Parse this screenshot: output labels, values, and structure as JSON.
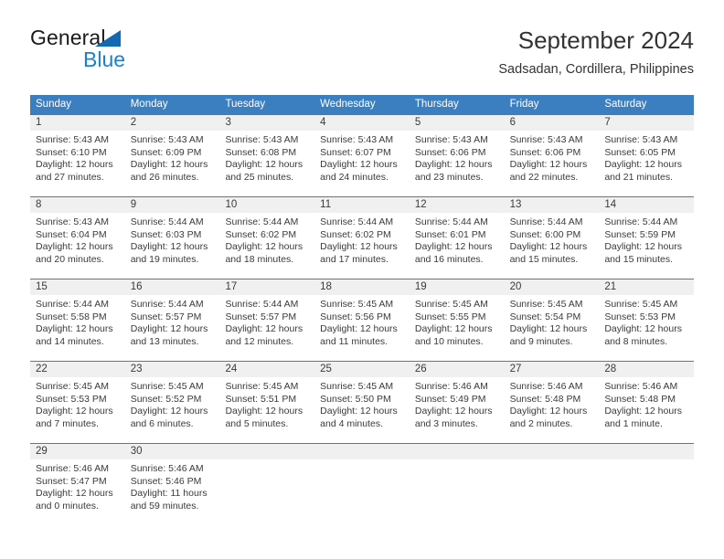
{
  "logo": {
    "word_top": "General",
    "word_bottom": "Blue",
    "triangle_icon": "triangle-icon",
    "color_dark": "#1a1a1a",
    "color_blue": "#1b7fd4"
  },
  "header": {
    "title": "September 2024",
    "subtitle": "Sadsadan, Cordillera, Philippines"
  },
  "theme": {
    "header_bg": "#3c7fc1",
    "header_text": "#ffffff",
    "daynum_bg": "#f0f0f0",
    "cell_bg": "#ffffff",
    "text": "#3a3a3a",
    "week_divider": "#3c7fc1"
  },
  "weekdays": [
    "Sunday",
    "Monday",
    "Tuesday",
    "Wednesday",
    "Thursday",
    "Friday",
    "Saturday"
  ],
  "weeks": [
    {
      "numbers": [
        "1",
        "2",
        "3",
        "4",
        "5",
        "6",
        "7"
      ],
      "days": [
        {
          "sunrise": "Sunrise: 5:43 AM",
          "sunset": "Sunset: 6:10 PM",
          "daylight1": "Daylight: 12 hours",
          "daylight2": "and 27 minutes."
        },
        {
          "sunrise": "Sunrise: 5:43 AM",
          "sunset": "Sunset: 6:09 PM",
          "daylight1": "Daylight: 12 hours",
          "daylight2": "and 26 minutes."
        },
        {
          "sunrise": "Sunrise: 5:43 AM",
          "sunset": "Sunset: 6:08 PM",
          "daylight1": "Daylight: 12 hours",
          "daylight2": "and 25 minutes."
        },
        {
          "sunrise": "Sunrise: 5:43 AM",
          "sunset": "Sunset: 6:07 PM",
          "daylight1": "Daylight: 12 hours",
          "daylight2": "and 24 minutes."
        },
        {
          "sunrise": "Sunrise: 5:43 AM",
          "sunset": "Sunset: 6:06 PM",
          "daylight1": "Daylight: 12 hours",
          "daylight2": "and 23 minutes."
        },
        {
          "sunrise": "Sunrise: 5:43 AM",
          "sunset": "Sunset: 6:06 PM",
          "daylight1": "Daylight: 12 hours",
          "daylight2": "and 22 minutes."
        },
        {
          "sunrise": "Sunrise: 5:43 AM",
          "sunset": "Sunset: 6:05 PM",
          "daylight1": "Daylight: 12 hours",
          "daylight2": "and 21 minutes."
        }
      ]
    },
    {
      "numbers": [
        "8",
        "9",
        "10",
        "11",
        "12",
        "13",
        "14"
      ],
      "days": [
        {
          "sunrise": "Sunrise: 5:43 AM",
          "sunset": "Sunset: 6:04 PM",
          "daylight1": "Daylight: 12 hours",
          "daylight2": "and 20 minutes."
        },
        {
          "sunrise": "Sunrise: 5:44 AM",
          "sunset": "Sunset: 6:03 PM",
          "daylight1": "Daylight: 12 hours",
          "daylight2": "and 19 minutes."
        },
        {
          "sunrise": "Sunrise: 5:44 AM",
          "sunset": "Sunset: 6:02 PM",
          "daylight1": "Daylight: 12 hours",
          "daylight2": "and 18 minutes."
        },
        {
          "sunrise": "Sunrise: 5:44 AM",
          "sunset": "Sunset: 6:02 PM",
          "daylight1": "Daylight: 12 hours",
          "daylight2": "and 17 minutes."
        },
        {
          "sunrise": "Sunrise: 5:44 AM",
          "sunset": "Sunset: 6:01 PM",
          "daylight1": "Daylight: 12 hours",
          "daylight2": "and 16 minutes."
        },
        {
          "sunrise": "Sunrise: 5:44 AM",
          "sunset": "Sunset: 6:00 PM",
          "daylight1": "Daylight: 12 hours",
          "daylight2": "and 15 minutes."
        },
        {
          "sunrise": "Sunrise: 5:44 AM",
          "sunset": "Sunset: 5:59 PM",
          "daylight1": "Daylight: 12 hours",
          "daylight2": "and 15 minutes."
        }
      ]
    },
    {
      "numbers": [
        "15",
        "16",
        "17",
        "18",
        "19",
        "20",
        "21"
      ],
      "days": [
        {
          "sunrise": "Sunrise: 5:44 AM",
          "sunset": "Sunset: 5:58 PM",
          "daylight1": "Daylight: 12 hours",
          "daylight2": "and 14 minutes."
        },
        {
          "sunrise": "Sunrise: 5:44 AM",
          "sunset": "Sunset: 5:57 PM",
          "daylight1": "Daylight: 12 hours",
          "daylight2": "and 13 minutes."
        },
        {
          "sunrise": "Sunrise: 5:44 AM",
          "sunset": "Sunset: 5:57 PM",
          "daylight1": "Daylight: 12 hours",
          "daylight2": "and 12 minutes."
        },
        {
          "sunrise": "Sunrise: 5:45 AM",
          "sunset": "Sunset: 5:56 PM",
          "daylight1": "Daylight: 12 hours",
          "daylight2": "and 11 minutes."
        },
        {
          "sunrise": "Sunrise: 5:45 AM",
          "sunset": "Sunset: 5:55 PM",
          "daylight1": "Daylight: 12 hours",
          "daylight2": "and 10 minutes."
        },
        {
          "sunrise": "Sunrise: 5:45 AM",
          "sunset": "Sunset: 5:54 PM",
          "daylight1": "Daylight: 12 hours",
          "daylight2": "and 9 minutes."
        },
        {
          "sunrise": "Sunrise: 5:45 AM",
          "sunset": "Sunset: 5:53 PM",
          "daylight1": "Daylight: 12 hours",
          "daylight2": "and 8 minutes."
        }
      ]
    },
    {
      "numbers": [
        "22",
        "23",
        "24",
        "25",
        "26",
        "27",
        "28"
      ],
      "days": [
        {
          "sunrise": "Sunrise: 5:45 AM",
          "sunset": "Sunset: 5:53 PM",
          "daylight1": "Daylight: 12 hours",
          "daylight2": "and 7 minutes."
        },
        {
          "sunrise": "Sunrise: 5:45 AM",
          "sunset": "Sunset: 5:52 PM",
          "daylight1": "Daylight: 12 hours",
          "daylight2": "and 6 minutes."
        },
        {
          "sunrise": "Sunrise: 5:45 AM",
          "sunset": "Sunset: 5:51 PM",
          "daylight1": "Daylight: 12 hours",
          "daylight2": "and 5 minutes."
        },
        {
          "sunrise": "Sunrise: 5:45 AM",
          "sunset": "Sunset: 5:50 PM",
          "daylight1": "Daylight: 12 hours",
          "daylight2": "and 4 minutes."
        },
        {
          "sunrise": "Sunrise: 5:46 AM",
          "sunset": "Sunset: 5:49 PM",
          "daylight1": "Daylight: 12 hours",
          "daylight2": "and 3 minutes."
        },
        {
          "sunrise": "Sunrise: 5:46 AM",
          "sunset": "Sunset: 5:48 PM",
          "daylight1": "Daylight: 12 hours",
          "daylight2": "and 2 minutes."
        },
        {
          "sunrise": "Sunrise: 5:46 AM",
          "sunset": "Sunset: 5:48 PM",
          "daylight1": "Daylight: 12 hours",
          "daylight2": "and 1 minute."
        }
      ]
    },
    {
      "numbers": [
        "29",
        "30",
        "",
        "",
        "",
        "",
        ""
      ],
      "days": [
        {
          "sunrise": "Sunrise: 5:46 AM",
          "sunset": "Sunset: 5:47 PM",
          "daylight1": "Daylight: 12 hours",
          "daylight2": "and 0 minutes."
        },
        {
          "sunrise": "Sunrise: 5:46 AM",
          "sunset": "Sunset: 5:46 PM",
          "daylight1": "Daylight: 11 hours",
          "daylight2": "and 59 minutes."
        },
        {
          "sunrise": "",
          "sunset": "",
          "daylight1": "",
          "daylight2": ""
        },
        {
          "sunrise": "",
          "sunset": "",
          "daylight1": "",
          "daylight2": ""
        },
        {
          "sunrise": "",
          "sunset": "",
          "daylight1": "",
          "daylight2": ""
        },
        {
          "sunrise": "",
          "sunset": "",
          "daylight1": "",
          "daylight2": ""
        },
        {
          "sunrise": "",
          "sunset": "",
          "daylight1": "",
          "daylight2": ""
        }
      ]
    }
  ]
}
